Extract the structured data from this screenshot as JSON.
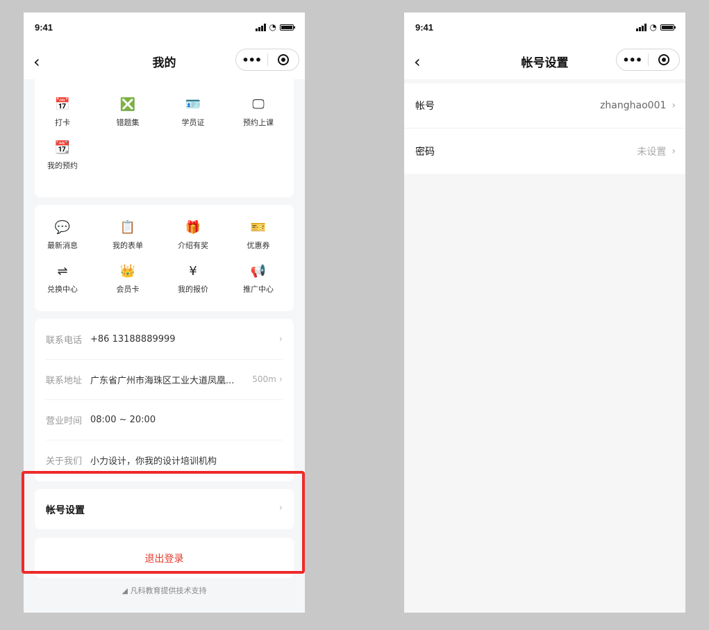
{
  "status_bar": {
    "time": "9:41"
  },
  "left_screen": {
    "title": "我的",
    "back_icon": "‹",
    "top_grid": [
      {
        "label": "打卡",
        "icon": "calendar-check-icon",
        "glyph": "📅"
      },
      {
        "label": "错题集",
        "icon": "error-book-icon",
        "glyph": "❎"
      },
      {
        "label": "学员证",
        "icon": "student-card-icon",
        "glyph": "🪪"
      },
      {
        "label": "预约上课",
        "icon": "class-board-icon",
        "glyph": "🖵"
      },
      {
        "label": "我的预约",
        "icon": "calendar-booking-icon",
        "glyph": "📆"
      }
    ],
    "services_grid": [
      {
        "label": "最新消息",
        "icon": "message-icon",
        "glyph": "💬"
      },
      {
        "label": "我的表单",
        "icon": "form-icon",
        "glyph": "📋"
      },
      {
        "label": "介绍有奖",
        "icon": "gift-icon",
        "glyph": "🎁"
      },
      {
        "label": "优惠券",
        "icon": "coupon-icon",
        "glyph": "🎫"
      },
      {
        "label": "兑换中心",
        "icon": "exchange-icon",
        "glyph": "⇌"
      },
      {
        "label": "会员卡",
        "icon": "member-crown-icon",
        "glyph": "👑"
      },
      {
        "label": "我的报价",
        "icon": "price-icon",
        "glyph": "¥"
      },
      {
        "label": "推广中心",
        "icon": "megaphone-icon",
        "glyph": "📢"
      }
    ],
    "info": {
      "phone_label": "联系电话",
      "phone_value": "+86 13188889999",
      "address_label": "联系地址",
      "address_value": "广东省广州市海珠区工业大道凤凰...",
      "address_distance": "500m",
      "hours_label": "营业时间",
      "hours_value": "08:00 ~ 20:00",
      "about_label": "关于我们",
      "about_value": "小力设计，你我的设计培训机构"
    },
    "account_settings_label": "帐号设置",
    "logout_label": "退出登录",
    "footer_text": "凡科教育提供技术支持"
  },
  "right_screen": {
    "title": "帐号设置",
    "rows": [
      {
        "label": "帐号",
        "value": "zhanghao001"
      },
      {
        "label": "密码",
        "value": "未设置"
      }
    ]
  },
  "colors": {
    "highlight": "#ee2a2a",
    "logout": "#e33b2e",
    "background": "#c8c8c8"
  }
}
